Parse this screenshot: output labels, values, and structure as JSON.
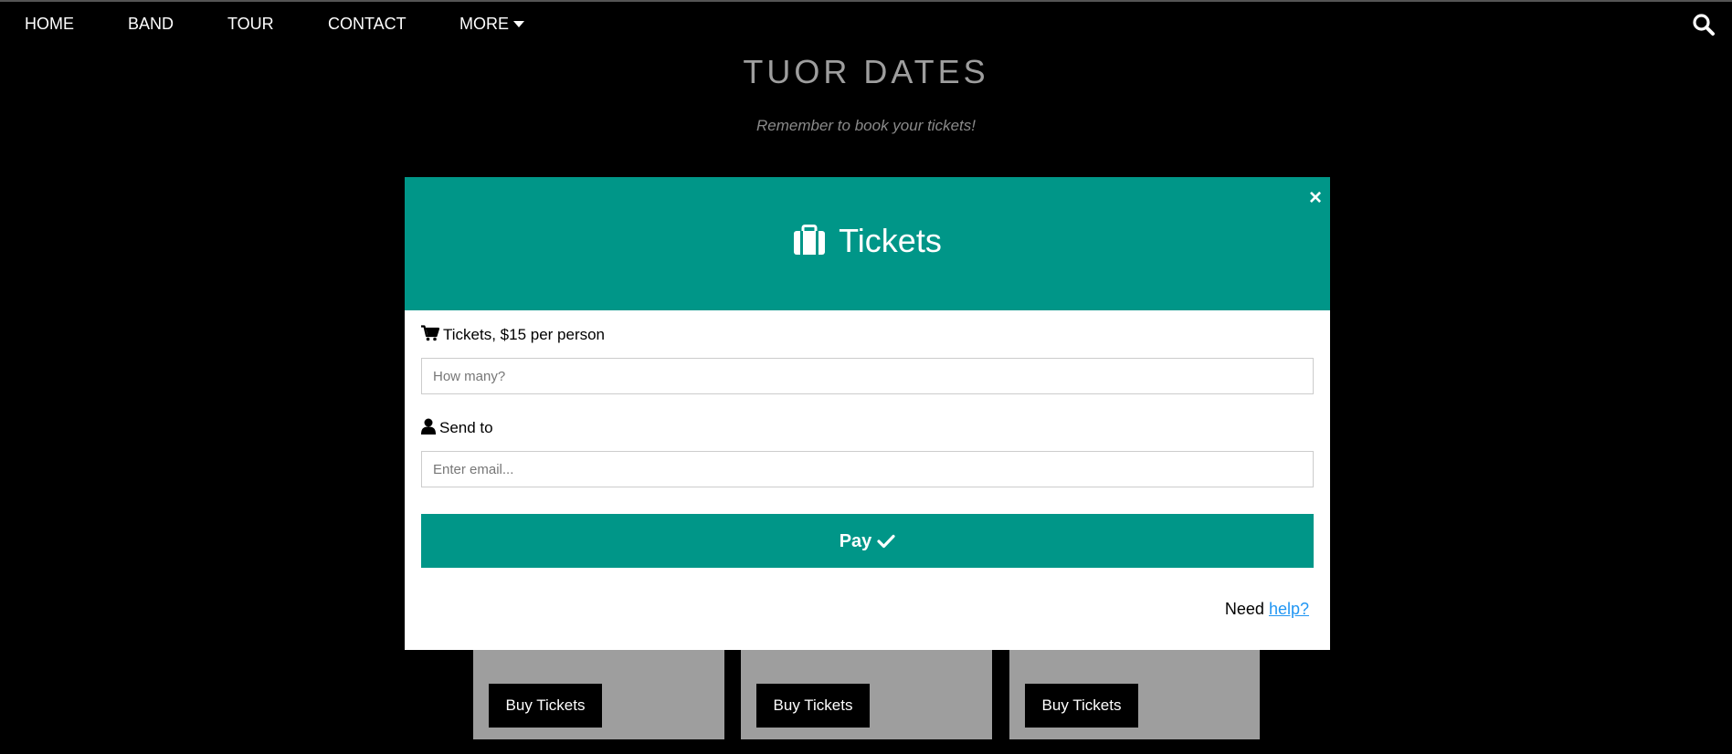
{
  "nav": {
    "items": [
      {
        "label": "HOME"
      },
      {
        "label": "BAND"
      },
      {
        "label": "TOUR"
      },
      {
        "label": "CONTACT"
      },
      {
        "label": "MORE"
      }
    ],
    "search_icon": "search-icon"
  },
  "tour": {
    "title": "TUOR DATES",
    "subtitle": "Remember to book your tickets!"
  },
  "cards": [
    {
      "button_label": "Buy Tickets"
    },
    {
      "button_label": "Buy Tickets"
    },
    {
      "button_label": "Buy Tickets"
    }
  ],
  "modal": {
    "close_label": "×",
    "title": "Tickets",
    "title_icon": "briefcase-icon",
    "tickets_label": "Tickets, $15 per person",
    "tickets_icon": "cart-icon",
    "quantity_placeholder": "How many?",
    "send_label": "Send to",
    "send_icon": "user-icon",
    "email_placeholder": "Enter email...",
    "pay_label": "Pay",
    "pay_icon": "check-icon",
    "help_prefix": "Need ",
    "help_link": "help?"
  },
  "colors": {
    "accent": "#009688",
    "link": "#2196f3",
    "card_bg": "#9e9e9e",
    "page_bg": "#000000"
  }
}
